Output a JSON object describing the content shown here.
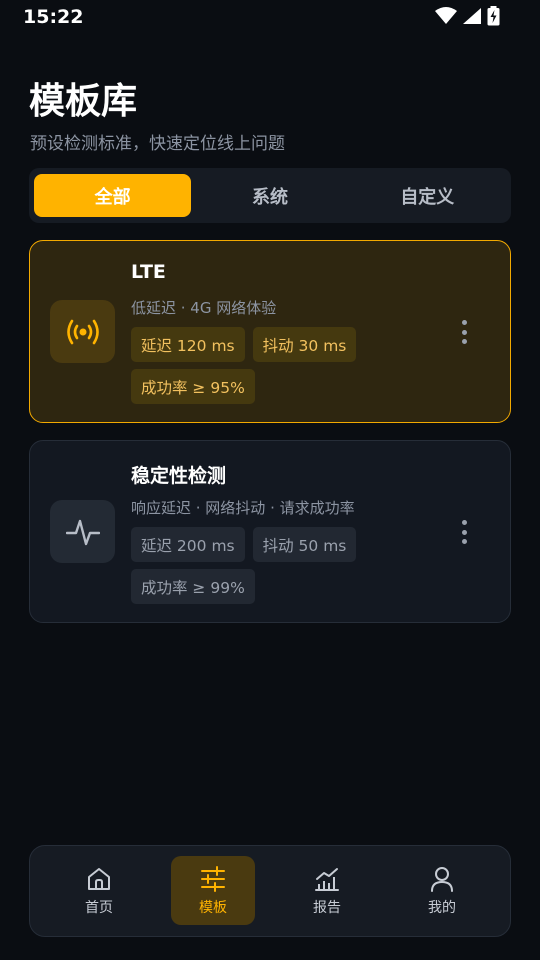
{
  "status_bar": {
    "time": "15:22"
  },
  "header": {
    "title": "模板库",
    "subtitle": "预设检测标准，快速定位线上问题"
  },
  "tabs": [
    {
      "label": "全部",
      "active": true
    },
    {
      "label": "系统",
      "active": false
    },
    {
      "label": "自定义",
      "active": false
    }
  ],
  "templates": [
    {
      "title": "LTE",
      "description": "低延迟 · 4G 网络体验",
      "chips": [
        "延迟 120 ms",
        "抖动 30 ms",
        "成功率 ≥ 95%"
      ],
      "icon": "signal-broadcast-icon",
      "selected": true
    },
    {
      "title": "稳定性检测",
      "description": "响应延迟 · 网络抖动 · 请求成功率",
      "chips": [
        "延迟 200 ms",
        "抖动 50 ms",
        "成功率 ≥ 99%"
      ],
      "icon": "pulse-wave-icon",
      "selected": false
    }
  ],
  "bottom_nav": [
    {
      "label": "首页",
      "icon": "home-icon",
      "active": false
    },
    {
      "label": "模板",
      "icon": "sliders-icon",
      "active": true
    },
    {
      "label": "报告",
      "icon": "chart-icon",
      "active": false
    },
    {
      "label": "我的",
      "icon": "user-icon",
      "active": false
    }
  ],
  "colors": {
    "background": "#0a0d12",
    "accent": "#ffb300",
    "card": "#131821",
    "highlight_card": "#2e2610"
  }
}
